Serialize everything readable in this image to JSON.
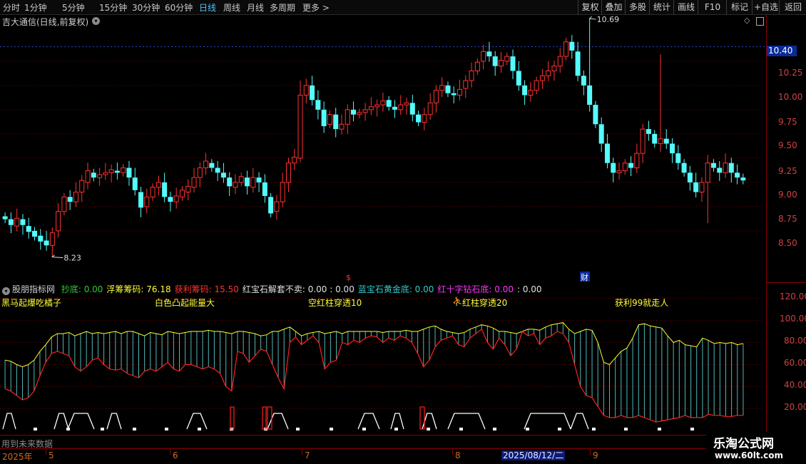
{
  "toolbar": {
    "periods": [
      "分时",
      "1分钟",
      "5分钟",
      "15分钟",
      "30分钟",
      "60分钟",
      "日线",
      "周线",
      "月线",
      "多周期",
      "更多 >"
    ],
    "active_period": "日线",
    "right_buttons": [
      "复权",
      "叠加",
      "多股",
      "统计",
      "画线",
      "F10",
      "标记",
      "+自选",
      "返回"
    ]
  },
  "chart_title": "吉大通信(日线,前复权)",
  "price_axis": {
    "ticks": [
      "10.25",
      "10.00",
      "9.75",
      "9.50",
      "9.25",
      "9.00",
      "8.75",
      "8.50"
    ],
    "current_price": "10.40",
    "high_label": "10.69",
    "low_label": "8.23"
  },
  "markers": {
    "dollar_sign": "$",
    "cai_label": "财"
  },
  "indicator": {
    "name": "股朋指标网",
    "items": [
      {
        "label": "抄底:",
        "value": "0.00",
        "color": "#33cc33"
      },
      {
        "label": "浮筹筹码:",
        "value": "76.18",
        "color": "#ffff33"
      },
      {
        "label": "获利筹码:",
        "value": "15.50",
        "color": "#ff3333"
      },
      {
        "label": "红宝石解套不卖:",
        "value": "0.00 : 0.00",
        "color": "#e0e0e0"
      },
      {
        "label": "蓝宝石黄金底:",
        "value": "0.00",
        "color": "#33cccc"
      },
      {
        "label": "红十字钻石底:",
        "value": "0.00",
        "color": "#ff33ff"
      },
      {
        "label": "",
        "value": ": 0.00",
        "color": "#e0e0e0"
      }
    ],
    "axis_ticks": [
      "120.00",
      "100.00",
      "80.00",
      "60.00",
      "40.00",
      "20.00"
    ]
  },
  "signals": [
    "黑马起爆吃橘子",
    "白色凸起能量大",
    "空红柱穿透10",
    "红柱穿透20",
    "获利99就走人"
  ],
  "footer_note": "用到未来数据",
  "datebar": {
    "labels": [
      "2025年",
      "5",
      "6",
      "7",
      "8",
      "9"
    ],
    "highlighted_date": "2025/08/12/二"
  },
  "brand": {
    "name": "乐淘公式网",
    "url": "www.60lt.com"
  },
  "colors": {
    "up": "#ff3333",
    "down": "#54fcfc",
    "bg": "#000000",
    "grid": "#7a0000"
  },
  "chart_data": {
    "type": "candlestick",
    "open": [
      8.65,
      8.62,
      8.55,
      8.62,
      8.55,
      8.5,
      8.45,
      8.4,
      8.35,
      8.5,
      8.7,
      8.85,
      8.8,
      8.9,
      9.0,
      9.1,
      9.05,
      9.08,
      9.1,
      9.12,
      9.1,
      9.15,
      9.05,
      8.9,
      8.75,
      8.85,
      8.95,
      9.0,
      8.85,
      8.8,
      8.85,
      8.9,
      8.95,
      9.05,
      9.15,
      9.2,
      9.15,
      9.1,
      9.05,
      8.95,
      9.0,
      9.05,
      8.95,
      9.05,
      9.0,
      8.85,
      8.7,
      8.8,
      9.0,
      9.2,
      9.25,
      9.9,
      10.0,
      9.85,
      9.75,
      9.6,
      9.7,
      9.55,
      9.6,
      9.75,
      9.7,
      9.72,
      9.75,
      9.78,
      9.8,
      9.85,
      9.78,
      9.75,
      9.8,
      9.82,
      9.7,
      9.62,
      9.7,
      9.82,
      9.95,
      10.0,
      9.92,
      9.9,
      9.97,
      10.05,
      10.15,
      10.25,
      10.35,
      10.3,
      10.2,
      10.25,
      10.3,
      10.15,
      10.0,
      9.9,
      9.95,
      10.05,
      10.1,
      10.15,
      10.2,
      10.3,
      10.45,
      10.35,
      10.1,
      10.0,
      9.8,
      9.6,
      9.4,
      9.2,
      9.1,
      9.12,
      9.2,
      9.15,
      9.3,
      9.55,
      9.5,
      9.4,
      9.45,
      9.4,
      9.3,
      9.2,
      9.1,
      9.0,
      8.9,
      9.0,
      9.2,
      9.15,
      9.1,
      9.2,
      9.1,
      9.05
    ],
    "close": [
      8.62,
      8.56,
      8.63,
      8.56,
      8.49,
      8.44,
      8.39,
      8.35,
      8.48,
      8.7,
      8.85,
      8.8,
      8.9,
      9.02,
      9.12,
      9.05,
      9.08,
      9.1,
      9.13,
      9.1,
      9.15,
      9.05,
      8.92,
      8.74,
      8.85,
      8.95,
      9.0,
      8.85,
      8.8,
      8.86,
      8.92,
      8.96,
      9.05,
      9.15,
      9.22,
      9.15,
      9.1,
      9.05,
      8.96,
      9.0,
      9.06,
      8.96,
      9.05,
      9.0,
      8.86,
      8.68,
      8.8,
      9.0,
      9.2,
      9.26,
      9.9,
      10.0,
      9.85,
      9.75,
      9.58,
      9.7,
      9.55,
      9.6,
      9.75,
      9.7,
      9.72,
      9.75,
      9.78,
      9.8,
      9.84,
      9.78,
      9.75,
      9.8,
      9.82,
      9.7,
      9.62,
      9.7,
      9.82,
      9.95,
      10.0,
      9.92,
      9.9,
      9.96,
      10.05,
      10.15,
      10.24,
      10.35,
      10.3,
      10.2,
      10.26,
      10.3,
      10.15,
      10.0,
      9.9,
      9.95,
      10.05,
      10.1,
      10.15,
      10.2,
      10.3,
      10.45,
      10.36,
      10.1,
      10.0,
      9.8,
      9.6,
      9.4,
      9.2,
      9.1,
      9.12,
      9.2,
      9.15,
      9.3,
      9.55,
      9.5,
      9.4,
      9.45,
      9.4,
      9.3,
      9.2,
      9.1,
      9.0,
      8.9,
      9.0,
      9.2,
      9.15,
      9.1,
      9.2,
      9.1,
      9.05,
      9.02
    ],
    "high_point": 10.69,
    "low_point": 8.23,
    "indicator_series": {
      "upper": [
        64,
        63,
        60,
        58,
        60,
        64,
        72,
        78,
        85,
        88,
        88,
        89,
        86,
        88,
        90,
        88,
        89,
        88,
        89,
        90,
        88,
        90,
        90,
        88,
        86,
        89,
        88,
        87,
        90,
        89,
        88,
        89,
        90,
        90,
        90,
        91,
        90,
        90,
        89,
        88,
        90,
        90,
        89,
        88,
        86,
        87,
        90,
        90,
        92,
        94,
        90,
        86,
        88,
        89,
        90,
        88,
        89,
        90,
        88,
        90,
        90,
        90,
        90,
        90,
        90,
        89,
        90,
        90,
        90,
        91,
        90,
        90,
        92,
        94,
        95,
        92,
        90,
        89,
        88,
        89,
        92,
        94,
        96,
        95,
        93,
        90,
        90,
        89,
        88,
        90,
        92,
        92,
        91,
        94,
        96,
        97,
        98,
        92,
        88,
        90,
        92,
        91,
        80,
        62,
        60,
        66,
        72,
        75,
        84,
        96,
        97,
        95,
        94,
        93,
        86,
        80,
        82,
        78,
        77,
        76,
        84,
        82,
        79,
        80,
        79,
        80,
        78,
        79
      ],
      "lower": [
        38,
        36,
        32,
        28,
        30,
        36,
        50,
        62,
        70,
        72,
        70,
        68,
        58,
        54,
        58,
        64,
        66,
        60,
        56,
        55,
        56,
        52,
        50,
        48,
        54,
        56,
        54,
        58,
        62,
        56,
        54,
        60,
        60,
        58,
        56,
        58,
        56,
        52,
        40,
        36,
        72,
        70,
        62,
        68,
        74,
        72,
        60,
        48,
        38,
        80,
        85,
        78,
        82,
        86,
        80,
        56,
        62,
        64,
        80,
        78,
        82,
        80,
        84,
        86,
        85,
        80,
        84,
        82,
        86,
        84,
        80,
        70,
        58,
        64,
        76,
        82,
        84,
        86,
        78,
        76,
        84,
        88,
        92,
        80,
        74,
        84,
        78,
        68,
        74,
        90,
        86,
        88,
        78,
        84,
        86,
        90,
        88,
        80,
        60,
        40,
        32,
        30,
        22,
        14,
        12,
        12,
        14,
        12,
        12,
        14,
        12,
        10,
        8,
        9,
        10,
        11,
        12,
        14,
        12,
        12,
        12,
        15,
        14,
        14,
        13,
        13,
        14,
        14
      ]
    }
  }
}
